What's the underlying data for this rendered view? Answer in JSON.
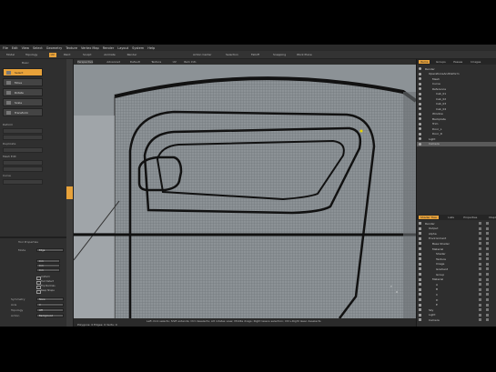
{
  "menubar": [
    "File",
    "Edit",
    "View",
    "Select",
    "Geometry",
    "Texture",
    "Vertex Map",
    "Render",
    "Layout",
    "System",
    "Help"
  ],
  "toolbar": {
    "tabs": [
      "Model",
      "Topology",
      "UV",
      "Paint",
      "Sculpt",
      "Animate",
      "Render"
    ],
    "active_index": 2,
    "right_items": [
      "Action Center",
      "Selection",
      "Falloff",
      "Snapping",
      "Work Plane"
    ]
  },
  "left_panel": {
    "title": "Basic",
    "tools": [
      "Select",
      "Move",
      "Rotate",
      "Scale",
      "Transform"
    ],
    "selected_tool": 0,
    "section_deform": "Deform",
    "section_duplicate": "Duplicate",
    "section_mesh_edit": "Mesh Edit",
    "section_curve": "Curve",
    "properties_title": "Tool Properties",
    "prop_mode_label": "Mode",
    "prop_mode_value": "Edge",
    "prop_fields": [
      "0 m",
      "0 m",
      "0 m"
    ],
    "checks": [
      "Uniform",
      "Tool Detect",
      "Flip Normals",
      "Keep Shape"
    ],
    "bottom_rows": [
      {
        "label": "Symmetry",
        "value": "None"
      },
      {
        "label": "Axis",
        "value": "X"
      },
      {
        "label": "Topology",
        "value": "Off"
      },
      {
        "label": "Action",
        "value": "Background"
      }
    ]
  },
  "viewport": {
    "tabs": [
      "Perspective",
      "Advanced",
      "Default",
      "Texture",
      "UV",
      "Item Info"
    ],
    "labels": [
      "Cam",
      "Shaded"
    ],
    "status_lines": [
      "Left click selects; Shift extends; Ctrl deselects; Alt rotates view; Middle drags; Right lassos selection; Ctrl+Right lasso deselects",
      "Polygons: 0  Edges: 0  Verts: 0"
    ]
  },
  "items_panel": {
    "tabs": [
      "Items",
      "Groups",
      "Passes",
      "Images"
    ],
    "active_tab": 0,
    "rows": [
      {
        "label": "Render",
        "depth": 0
      },
      {
        "label": "OperationsAndDeform",
        "depth": 1
      },
      {
        "label": "Mesh",
        "depth": 2
      },
      {
        "label": "Curve",
        "depth": 2
      },
      {
        "label": "Reference",
        "depth": 2
      },
      {
        "label": "Cab_01",
        "depth": 3
      },
      {
        "label": "Cab_02",
        "depth": 3
      },
      {
        "label": "Cab_03",
        "depth": 3
      },
      {
        "label": "Cab_04",
        "depth": 3
      },
      {
        "label": "Window",
        "depth": 2
      },
      {
        "label": "Backplate",
        "depth": 2
      },
      {
        "label": "Trim",
        "depth": 2
      },
      {
        "label": "Door_L",
        "depth": 2
      },
      {
        "label": "Door_R",
        "depth": 2
      },
      {
        "label": "Light",
        "depth": 1
      },
      {
        "label": "Camera",
        "depth": 1
      }
    ],
    "selected_row": 15
  },
  "shader_panel": {
    "tabs": [
      "Shader Tree",
      "Lists",
      "Properties",
      "Display"
    ],
    "active_tab": 0,
    "rows": [
      {
        "label": "Render",
        "depth": 0
      },
      {
        "label": "Output",
        "depth": 1
      },
      {
        "label": "Alpha",
        "depth": 1
      },
      {
        "label": "Environment",
        "depth": 1
      },
      {
        "label": "Base Shader",
        "depth": 2
      },
      {
        "label": "Material",
        "depth": 2
      },
      {
        "label": "Shader",
        "depth": 3
      },
      {
        "label": "Texture",
        "depth": 3
      },
      {
        "label": "Image",
        "depth": 3
      },
      {
        "label": "Gradient",
        "depth": 3
      },
      {
        "label": "Group",
        "depth": 3
      },
      {
        "label": "Material",
        "depth": 2
      },
      {
        "label": "A",
        "depth": 3
      },
      {
        "label": "B",
        "depth": 3
      },
      {
        "label": "C",
        "depth": 3
      },
      {
        "label": "D",
        "depth": 3
      },
      {
        "label": "E",
        "depth": 3
      },
      {
        "label": "Sky",
        "depth": 1
      },
      {
        "label": "Light",
        "depth": 1
      },
      {
        "label": "Camera",
        "depth": 1
      }
    ]
  },
  "colors": {
    "accent": "#e8a23a",
    "viewport": "#8d9295",
    "panel": "#2e2e2e"
  }
}
